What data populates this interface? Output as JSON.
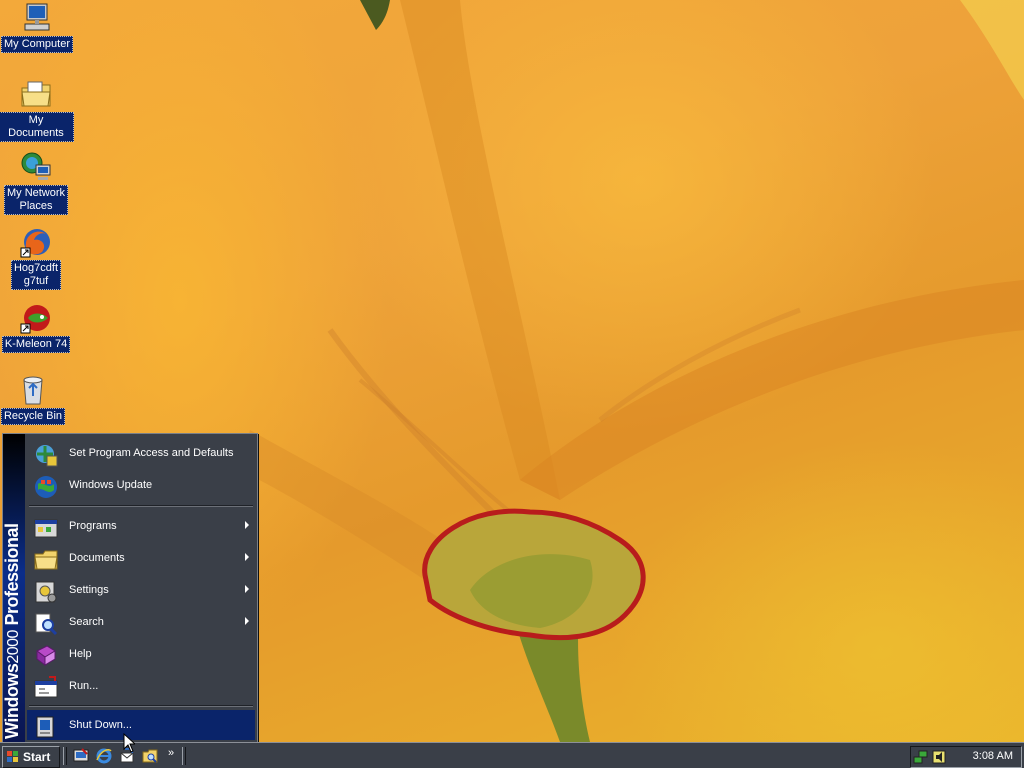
{
  "desktop": {
    "icons": [
      {
        "label_lines": [
          "My Computer"
        ],
        "icon": "my-computer-icon"
      },
      {
        "label_lines": [
          "My Documents"
        ],
        "icon": "folder-documents-icon"
      },
      {
        "label_lines": [
          "My Network",
          "Places"
        ],
        "icon": "network-places-icon"
      },
      {
        "label_lines": [
          "Hog7cdft",
          "g7tuf"
        ],
        "icon": "firefox-shortcut-icon"
      },
      {
        "label_lines": [
          "K-Meleon 74"
        ],
        "icon": "k-meleon-shortcut-icon"
      },
      {
        "label_lines": [
          "Recycle Bin"
        ],
        "icon": "recycle-bin-icon"
      }
    ]
  },
  "start_menu": {
    "banner": {
      "brand": "Windows",
      "version": "2000",
      "edition": "Professional"
    },
    "top_items": [
      {
        "label": "Set Program Access and Defaults",
        "icon": "program-access-icon"
      },
      {
        "label": "Windows Update",
        "icon": "windows-update-icon"
      }
    ],
    "main_items": [
      {
        "label": "Programs",
        "icon": "programs-icon",
        "submenu": true
      },
      {
        "label": "Documents",
        "icon": "documents-folder-icon",
        "submenu": true
      },
      {
        "label": "Settings",
        "icon": "settings-icon",
        "submenu": true
      },
      {
        "label": "Search",
        "icon": "search-icon",
        "submenu": true
      },
      {
        "label": "Help",
        "icon": "help-book-icon",
        "submenu": false
      },
      {
        "label": "Run...",
        "icon": "run-icon",
        "submenu": false
      }
    ],
    "bottom_items": [
      {
        "label": "Shut Down...",
        "icon": "shut-down-icon",
        "selected": true
      }
    ]
  },
  "taskbar": {
    "start_label": "Start",
    "quick_launch": [
      "show-desktop-icon",
      "internet-explorer-icon",
      "outlook-express-icon",
      "explorer-icon"
    ],
    "more_glyph": "»",
    "tray_icons": [
      "network-icon",
      "volume-icon"
    ],
    "clock": "3:08 AM"
  },
  "colors": {
    "menu_bg": "#3a3f48",
    "selection": "#0a246a",
    "banner": "#0b2d8a",
    "wallpaper": "#eea23a"
  }
}
